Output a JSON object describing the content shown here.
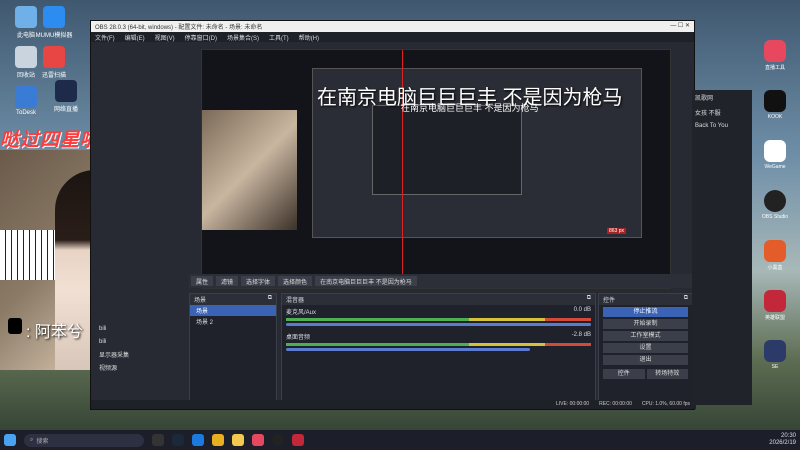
{
  "overlay_banner": "哒过四星啦 400/600",
  "preview_caption": "在南京电脑巨巨巨丰 不是因为枪马",
  "preview_caption_small": "在南京电脑巨巨巨丰 不是因为枪马",
  "preview_size_label": "863 px",
  "streamer_name": ": 阿苯兮",
  "desktop_icons": [
    {
      "label": "此电脑"
    },
    {
      "label": "MUMU模拟器"
    },
    {
      "label": "回收站"
    },
    {
      "label": "迅雷扫描"
    },
    {
      "label": "ToDesk"
    },
    {
      "label": "网络直播"
    }
  ],
  "obs": {
    "title": "OBS 28.0.3 (64-bit, windows) - 配置文件: 未命名 - 场景: 未命名",
    "menu": [
      "文件(F)",
      "编辑(E)",
      "视图(V)",
      "停靠窗口(D)",
      "场景集合(S)",
      "工具(T)",
      "帮助(H)"
    ],
    "source_toolbar": [
      "属性",
      "滤镜",
      "选择字体",
      "选择颜色",
      "在南京电脑巨巨巨丰 不是因为枪马"
    ],
    "scenes_header": "场景",
    "scenes": [
      "场景",
      "场景 2"
    ],
    "mixer_header": "混音器",
    "mixer": [
      {
        "name": "麦克风/Aux",
        "db": "0.0 dB"
      },
      {
        "name": "桌面音频",
        "db": "-2.8 dB"
      }
    ],
    "controls_header": "控件",
    "controls": [
      "停止推流",
      "开始录制",
      "工作室模式",
      "设置",
      "退出"
    ],
    "bottom_tabs": [
      "控件",
      "转场特效"
    ],
    "sources": [
      "bili",
      "bili",
      "显示器采集",
      "视频源"
    ],
    "status": {
      "live": "LIVE: 00:00:00",
      "rec": "REC: 00:00:00",
      "cpu": "CPU: 1.0%, 60.00 fps"
    }
  },
  "right_panel": [
    "凯歌网",
    "女孩 不服",
    "Back To You"
  ],
  "side_apps": [
    {
      "label": "直播工具"
    },
    {
      "label": "KOOK"
    },
    {
      "label": "WeGame"
    },
    {
      "label": "OBS Studio"
    },
    {
      "label": "小黑盒"
    },
    {
      "label": "英雄联盟"
    },
    {
      "label": "SE"
    },
    {
      "label": "回收站"
    }
  ],
  "taskbar": {
    "search_placeholder": "搜索",
    "time": "20:30",
    "date": "2026/2/19",
    "lang": "中"
  },
  "colors": {
    "obs_bg": "#272a33",
    "accent": "#3a63b5",
    "banner_red": "#ff3b3b"
  }
}
